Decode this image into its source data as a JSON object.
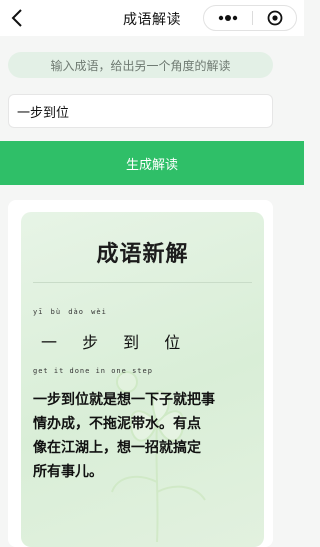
{
  "navbar": {
    "title": "成语解读"
  },
  "hint": {
    "text": "输入成语，给出另一个角度的解读"
  },
  "input": {
    "value": "一步到位"
  },
  "generate_button": {
    "label": "生成解读"
  },
  "card": {
    "title": "成语新解",
    "pinyin": "yī bù dào wèi",
    "idiom": "一 步 到 位",
    "english": "get it done in one step",
    "body_lines": [
      "一步到位就是想一下子就把事",
      "情办成，不拖泥带水。有点",
      "像在江湖上，想一招就搞定",
      "所有事儿。"
    ]
  },
  "colors": {
    "accent_green": "#2fbf68",
    "hint_bg": "#e3f0e6",
    "card_bg": "#e0f1de"
  },
  "icons": [
    "back-arrow-icon",
    "more-dots-icon",
    "close-target-icon",
    "flower-decoration-icon"
  ]
}
